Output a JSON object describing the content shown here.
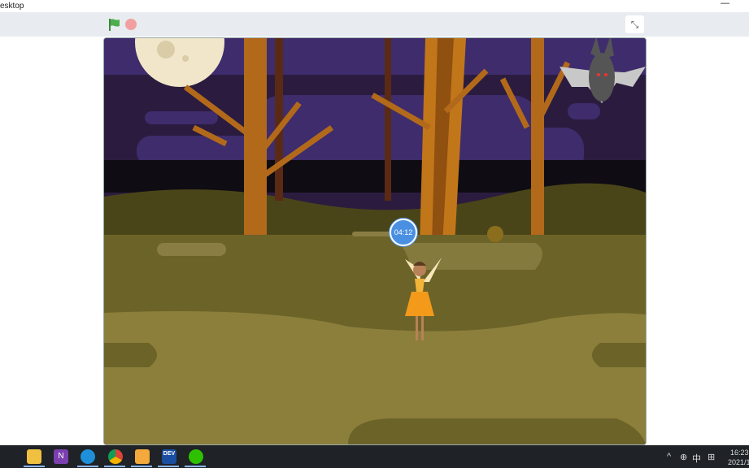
{
  "window": {
    "title": "esktop",
    "minimize": "—"
  },
  "toolbar": {
    "green_flag": "green-flag-icon",
    "stop": "stop-icon",
    "unfullscreen": "⤡"
  },
  "stage": {
    "timer": "04:12"
  },
  "taskbar": {
    "apps": [
      {
        "name": "file-explorer",
        "color": "#f0c040"
      },
      {
        "name": "onenote",
        "color": "#7b3fb0",
        "label": "N"
      },
      {
        "name": "edge",
        "color": "#1e8fd8"
      },
      {
        "name": "chrome",
        "color": "#e0a020"
      },
      {
        "name": "scratch-desktop",
        "color": "#f3a93b"
      },
      {
        "name": "dev-app",
        "color": "#1a4ea0",
        "label": "DEV"
      },
      {
        "name": "wechat",
        "color": "#2dc100"
      }
    ],
    "tray": {
      "chevron": "^",
      "globe": "⊕",
      "ime": "中",
      "grid": "⊞"
    },
    "clock": {
      "time": "16:23",
      "date": "2021/1"
    }
  }
}
